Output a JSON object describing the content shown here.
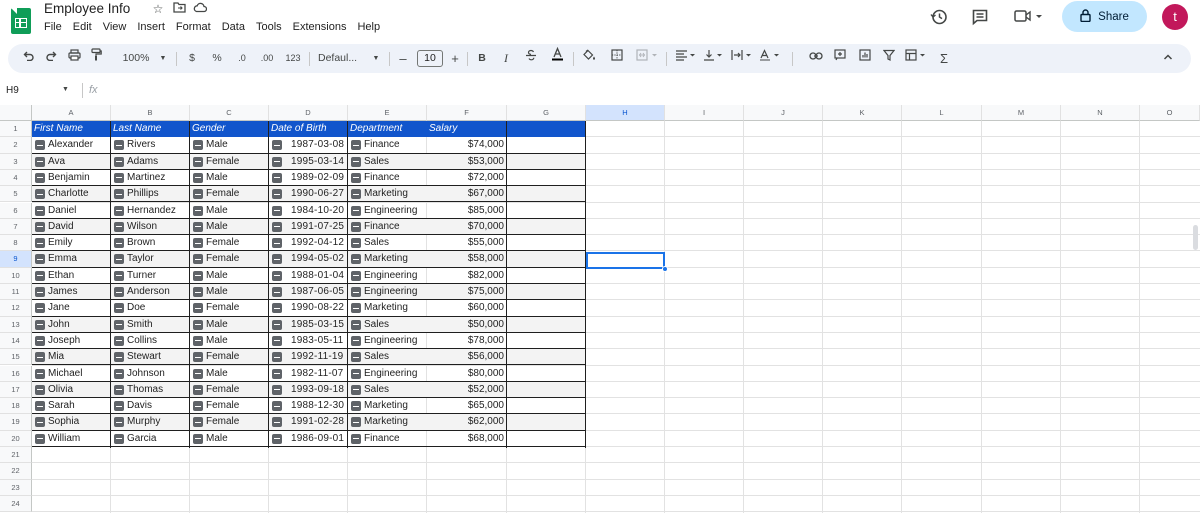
{
  "document": {
    "title": "Employee Info",
    "menu": [
      "File",
      "Edit",
      "View",
      "Insert",
      "Format",
      "Data",
      "Tools",
      "Extensions",
      "Help"
    ],
    "share_label": "Share",
    "avatar_letter": "t"
  },
  "toolbar": {
    "zoom": "100%",
    "currency": "$",
    "percent": "%",
    "decrease_decimal": ".0",
    "increase_decimal": ".00",
    "number_format": "123",
    "font": "Defaul...",
    "font_size": "10",
    "bold": "B",
    "italic": "I",
    "sigma": "Σ"
  },
  "formula_bar": {
    "name_box": "H9",
    "fx": "fx"
  },
  "columns": [
    "A",
    "B",
    "C",
    "D",
    "E",
    "F",
    "G",
    "H",
    "I",
    "J",
    "K",
    "L",
    "M",
    "N",
    "O"
  ],
  "rows": [
    "1",
    "2",
    "3",
    "4",
    "5",
    "6",
    "7",
    "8",
    "9",
    "10",
    "11",
    "12",
    "13",
    "14",
    "15",
    "16",
    "17",
    "18",
    "19",
    "20",
    "21",
    "22",
    "23",
    "24"
  ],
  "table": {
    "headers": [
      "First Name",
      "Last Name",
      "Gender",
      "Date of Birth",
      "Department",
      "Salary"
    ],
    "rows": [
      [
        "Alexander",
        "Rivers",
        "Male",
        "1987-03-08",
        "Finance",
        "$74,000"
      ],
      [
        "Ava",
        "Adams",
        "Female",
        "1995-03-14",
        "Sales",
        "$53,000"
      ],
      [
        "Benjamin",
        "Martinez",
        "Male",
        "1989-02-09",
        "Finance",
        "$72,000"
      ],
      [
        "Charlotte",
        "Phillips",
        "Female",
        "1990-06-27",
        "Marketing",
        "$67,000"
      ],
      [
        "Daniel",
        "Hernandez",
        "Male",
        "1984-10-20",
        "Engineering",
        "$85,000"
      ],
      [
        "David",
        "Wilson",
        "Male",
        "1991-07-25",
        "Finance",
        "$70,000"
      ],
      [
        "Emily",
        "Brown",
        "Female",
        "1992-04-12",
        "Sales",
        "$55,000"
      ],
      [
        "Emma",
        "Taylor",
        "Female",
        "1994-05-02",
        "Marketing",
        "$58,000"
      ],
      [
        "Ethan",
        "Turner",
        "Male",
        "1988-01-04",
        "Engineering",
        "$82,000"
      ],
      [
        "James",
        "Anderson",
        "Male",
        "1987-06-05",
        "Engineering",
        "$75,000"
      ],
      [
        "Jane",
        "Doe",
        "Female",
        "1990-08-22",
        "Marketing",
        "$60,000"
      ],
      [
        "John",
        "Smith",
        "Male",
        "1985-03-15",
        "Sales",
        "$50,000"
      ],
      [
        "Joseph",
        "Collins",
        "Male",
        "1983-05-11",
        "Engineering",
        "$78,000"
      ],
      [
        "Mia",
        "Stewart",
        "Female",
        "1992-11-19",
        "Sales",
        "$56,000"
      ],
      [
        "Michael",
        "Johnson",
        "Male",
        "1982-11-07",
        "Engineering",
        "$80,000"
      ],
      [
        "Olivia",
        "Thomas",
        "Female",
        "1993-09-18",
        "Sales",
        "$52,000"
      ],
      [
        "Sarah",
        "Davis",
        "Female",
        "1988-12-30",
        "Marketing",
        "$65,000"
      ],
      [
        "Sophia",
        "Murphy",
        "Female",
        "1991-02-28",
        "Marketing",
        "$62,000"
      ],
      [
        "William",
        "Garcia",
        "Male",
        "1986-09-01",
        "Finance",
        "$68,000"
      ]
    ]
  },
  "colors": {
    "header_fill": "#1155cc",
    "selection": "#1a73e8",
    "share_bg": "#c2e7ff",
    "avatar_bg": "#c2185b",
    "toolbar_bg": "#eef2f9"
  },
  "icons": [
    "star-icon",
    "move-folder-icon",
    "cloud-icon",
    "history-icon",
    "comment-icon",
    "video-icon",
    "lock-icon",
    "undo-icon",
    "redo-icon",
    "print-icon",
    "paint-format-icon",
    "strikethrough-icon",
    "text-color-icon",
    "fill-color-icon",
    "borders-icon",
    "merge-icon",
    "align-icon",
    "valign-icon",
    "wrap-icon",
    "rotate-icon",
    "link-icon",
    "comment-add-icon",
    "chart-icon",
    "filter-icon",
    "filter-views-icon",
    "function-icon",
    "collapse-icon"
  ]
}
